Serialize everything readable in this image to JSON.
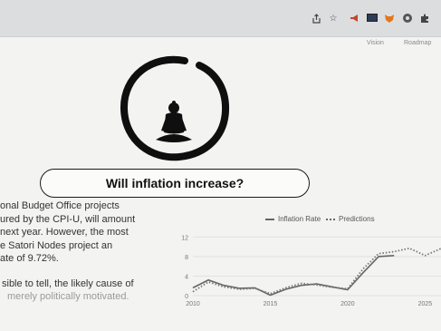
{
  "browser": {
    "icons": [
      "share-icon",
      "star-icon",
      "extension-icon",
      "extension-icon",
      "fox-icon",
      "profile-icon",
      "puzzle-icon"
    ]
  },
  "nav": {
    "links": [
      "Vision",
      "Roadmap"
    ]
  },
  "question": {
    "text": "Will inflation increase?"
  },
  "paragraph": {
    "lines": [
      "onal Budget Office projects",
      "ured by the CPI-U, will amount",
      "next year. However, the most",
      "e Satori Nodes project an",
      "ate of 9.72%."
    ],
    "lines2": [
      "sible to tell, the likely cause of",
      "merely politically motivated."
    ]
  },
  "chart_data": {
    "type": "line",
    "xlim": [
      2010,
      2026.5
    ],
    "ylim": [
      0,
      13
    ],
    "xticks": [
      2010,
      2015,
      2020,
      2025
    ],
    "yticks": [
      0,
      4,
      8,
      12
    ],
    "series": [
      {
        "name": "Inflation Rate",
        "style": "solid",
        "color": "#666666",
        "x": [
          2010,
          2011,
          2012,
          2013,
          2014,
          2015,
          2016,
          2017,
          2018,
          2019,
          2020,
          2021,
          2022,
          2023
        ],
        "y": [
          1.6,
          3.2,
          2.1,
          1.5,
          1.6,
          0.1,
          1.3,
          2.1,
          2.4,
          1.8,
          1.2,
          4.7,
          8.0,
          8.2
        ]
      },
      {
        "name": "Predictions",
        "style": "dotted",
        "color": "#777777",
        "x": [
          2010,
          2011,
          2012,
          2013,
          2014,
          2015,
          2016,
          2017,
          2018,
          2019,
          2020,
          2021,
          2022,
          2023,
          2024,
          2025,
          2026,
          2026.5
        ],
        "y": [
          0.8,
          2.8,
          1.8,
          1.3,
          1.5,
          0.4,
          1.6,
          2.5,
          2.2,
          1.7,
          1.4,
          5.5,
          8.6,
          9.0,
          9.7,
          8.2,
          9.6,
          9.8
        ]
      }
    ]
  }
}
